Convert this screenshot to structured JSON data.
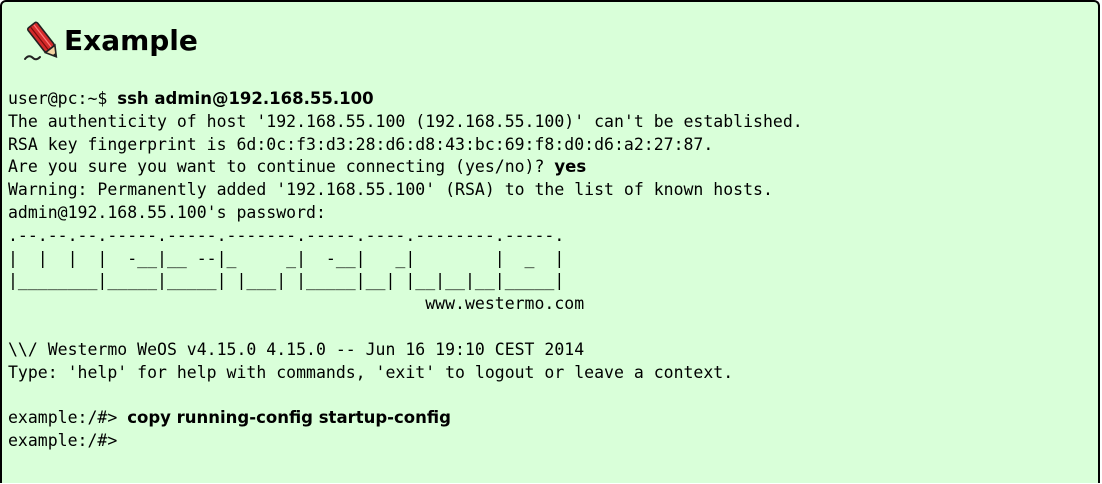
{
  "example": {
    "icon": "red-pen-icon",
    "title": "Example"
  },
  "terminal": {
    "login_prompt": "user@pc:~$ ",
    "login_command": "ssh admin@192.168.55.100",
    "authenticity": "The authenticity of host '192.168.55.100 (192.168.55.100)' can't be established.",
    "fingerprint": "RSA key fingerprint is 6d:0c:f3:d3:28:d6:d8:43:bc:69:f8:d0:d6:a2:27:87.",
    "confirm_prompt": "Are you sure you want to continue connecting (yes/no)? ",
    "confirm_answer": "yes",
    "warning": "Warning: Permanently added '192.168.55.100' (RSA) to the list of known hosts.",
    "password_prompt": "admin@192.168.55.100's password:",
    "banner": [
      ".--.--.--.-----.-----.-------.-----.----.--------.-----.",
      "|  |  |  |  -__|__ --|_     _|  -__|   _|        |  _  |",
      "|________|_____|_____| |___| |_____|__| |__|__|__|_____|",
      "                                          www.westermo.com"
    ],
    "blank": "",
    "version": "\\\\/ Westermo WeOS v4.15.0 4.15.0 -- Jun 16 19:10 CEST 2014",
    "help": "Type: 'help' for help with commands, 'exit' to logout or leave a context.",
    "cli_prompt": "example:/#> ",
    "cli_command": "copy running-config startup-config",
    "cli_prompt_end": "example:/#>"
  },
  "colors": {
    "box_background": "#d9ffd9",
    "border": "#000000",
    "icon_red": "#cc2222"
  }
}
